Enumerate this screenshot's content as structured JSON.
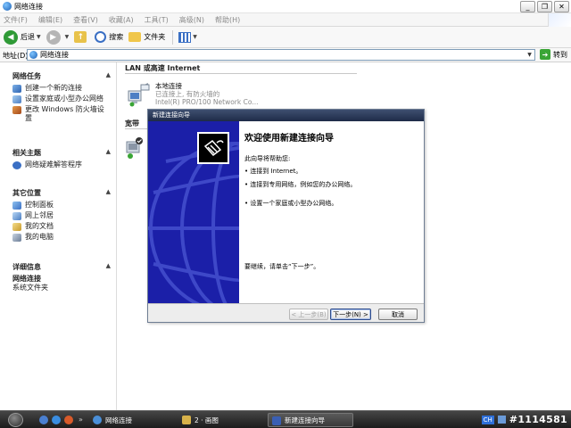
{
  "window": {
    "title": "网络连接",
    "buttons": {
      "minimize": "_",
      "restore": "❐",
      "close": "✕"
    }
  },
  "menu": [
    "文件(F)",
    "编辑(E)",
    "查看(V)",
    "收藏(A)",
    "工具(T)",
    "高级(N)",
    "帮助(H)"
  ],
  "toolbar": {
    "back_label": "后退",
    "search_label": "搜索",
    "folders_label": "文件夹"
  },
  "address": {
    "label": "地址(D)",
    "value": "网络连接",
    "go_label": "转到"
  },
  "sidebar": {
    "network_tasks": {
      "title": "网络任务",
      "items": [
        {
          "label": "创建一个新的连接",
          "icon": "new-connection-icon"
        },
        {
          "label": "设置家庭或小型办公网络",
          "icon": "home-network-icon"
        },
        {
          "label": "更改 Windows 防火墙设置",
          "icon": "firewall-icon"
        }
      ]
    },
    "see_also": {
      "title": "相关主题",
      "items": [
        {
          "label": "网络疑难解答程序",
          "icon": "help-icon"
        }
      ]
    },
    "other_places": {
      "title": "其它位置",
      "items": [
        {
          "label": "控制面板",
          "icon": "control-panel-icon"
        },
        {
          "label": "网上邻居",
          "icon": "network-places-icon"
        },
        {
          "label": "我的文档",
          "icon": "my-documents-icon"
        },
        {
          "label": "我的电脑",
          "icon": "my-computer-icon"
        }
      ]
    },
    "details": {
      "title": "详细信息",
      "name": "网络连接",
      "type": "系统文件夹"
    }
  },
  "content": {
    "group_lan": "LAN 或高速 Internet",
    "group_broadband": "宽带",
    "connection": {
      "name": "本地连接",
      "status": "已连接上, 有防火墙的",
      "device": "Intel(R) PRO/100 Network Co..."
    }
  },
  "wizard": {
    "title": "新建连接向导",
    "heading": "欢迎使用新建连接向导",
    "intro": "此向导将帮助您:",
    "bullets": [
      "连接到 Internet。",
      "连接到专用网络，例如您的办公网络。",
      "设置一个家庭或小型办公网络。"
    ],
    "continue_text": "要继续，请单击“下一步”。",
    "buttons": {
      "back": "< 上一步(B)",
      "next": "下一步(N) >",
      "cancel": "取消"
    }
  },
  "taskbar": {
    "tasks": [
      {
        "label": "网络连接"
      },
      {
        "label": "2 · 画图"
      },
      {
        "label": "新建连接向导",
        "active": true
      }
    ],
    "tray": {
      "ime": "CH",
      "watermark": "#1114581"
    }
  }
}
